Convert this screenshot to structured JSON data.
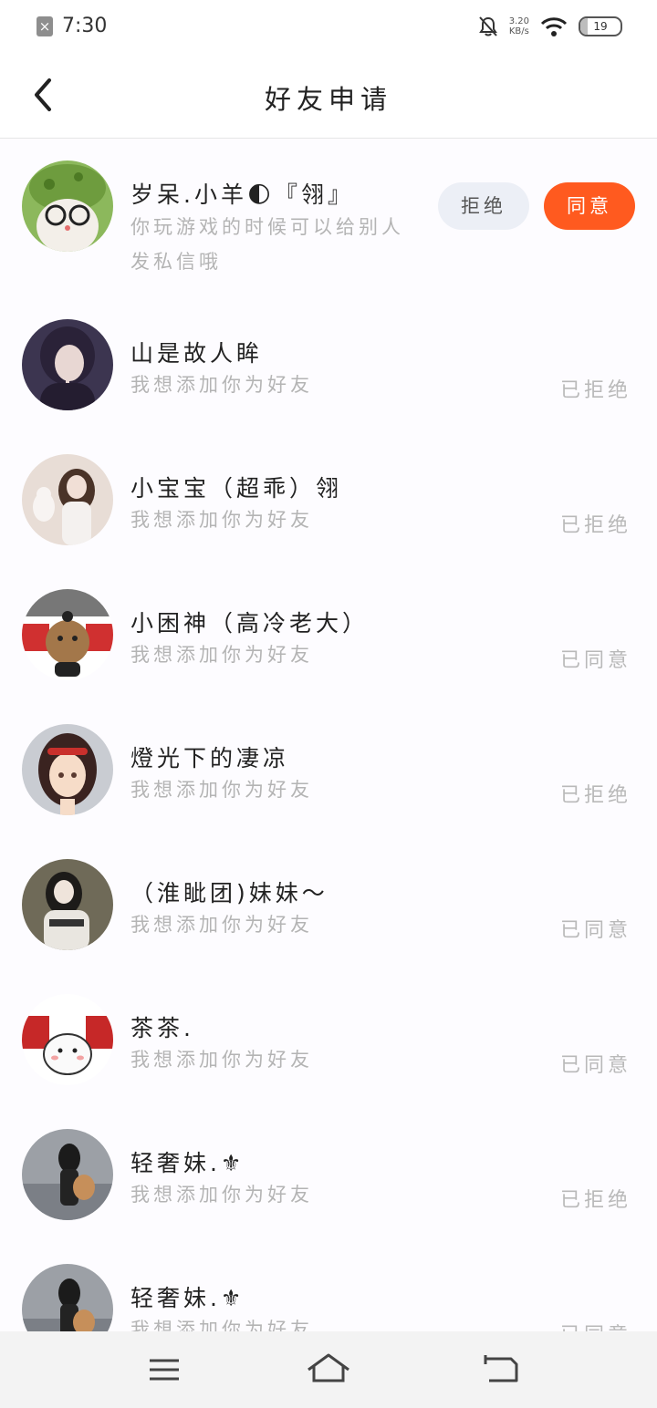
{
  "status_bar": {
    "time": "7:30",
    "net_speed_value": "3.20",
    "net_speed_unit": "KB/s",
    "battery": "19",
    "battery_level": 0.19
  },
  "header": {
    "title": "好友申请"
  },
  "requests": [
    {
      "name": "岁呆.小羊🌓『翎』",
      "message": "你玩游戏的时候可以给别人发私信哦",
      "reject_label": "拒绝",
      "accept_label": "同意"
    },
    {
      "name": "山是故人眸",
      "message": "我想添加你为好友",
      "status": "已拒绝"
    },
    {
      "name": "小宝宝（超乖）翎",
      "message": "我想添加你为好友",
      "status": "已拒绝"
    },
    {
      "name": "小困神（高冷老大）",
      "message": "我想添加你为好友",
      "status": "已同意"
    },
    {
      "name": "燈光下的凄凉",
      "message": "我想添加你为好友",
      "status": "已拒绝"
    },
    {
      "name": "（淮眦团)妹妹～",
      "message": "我想添加你为好友",
      "status": "已同意"
    },
    {
      "name": "茶茶.",
      "message": "我想添加你为好友",
      "status": "已同意"
    },
    {
      "name": "轻奢妹.⚜",
      "message": "我想添加你为好友",
      "status": "已拒绝"
    },
    {
      "name": "轻奢妹.⚜",
      "message": "我想添加你为好友",
      "status": "已同意"
    }
  ],
  "colors": {
    "accent": "#ff5a1f",
    "reject_bg": "#eceff6",
    "muted_text": "#b4b4b4"
  }
}
